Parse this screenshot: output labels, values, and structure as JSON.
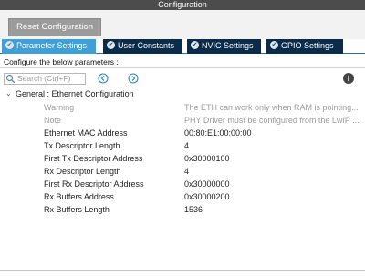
{
  "window": {
    "title": "Configuration"
  },
  "toolbar": {
    "reset_label": "Reset Configuration"
  },
  "tabs": [
    {
      "label": "Parameter Settings",
      "active": true
    },
    {
      "label": "User Constants",
      "active": false
    },
    {
      "label": "NVIC Settings",
      "active": false
    },
    {
      "label": "GPIO Settings",
      "active": false
    }
  ],
  "description": "Configure the below parameters :",
  "search": {
    "placeholder": "Search (Ctrl+F)"
  },
  "group": {
    "label": "General : Ethernet Configuration"
  },
  "params": [
    {
      "name": "Warning",
      "value": "The ETH can work only when RAM is pointing...",
      "disabled": true
    },
    {
      "name": "Note",
      "value": "PHY Driver must be configured from the LwIP ...",
      "disabled": true
    },
    {
      "name": "Ethernet MAC Address",
      "value": "00:80:E1:00:00:00"
    },
    {
      "name": "Tx Descriptor Length",
      "value": "4"
    },
    {
      "name": "First Tx Descriptor Address",
      "value": "0x30000100"
    },
    {
      "name": "Rx Descriptor Length",
      "value": "4"
    },
    {
      "name": "First Rx Descriptor Address",
      "value": "0x30000000"
    },
    {
      "name": "Rx Buffers Address",
      "value": "0x30000200"
    },
    {
      "name": "Rx Buffers Length",
      "value": "1536"
    }
  ]
}
